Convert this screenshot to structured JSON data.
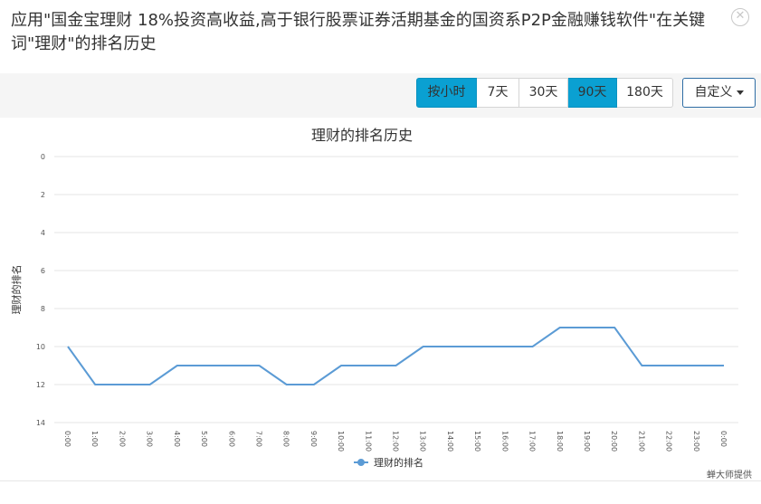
{
  "header": {
    "title": "应用\"国金宝理财 18%投资高收益,高于银行股票证券活期基金的国资系P2P金融赚钱软件\"在关键词\"理财\"的排名历史",
    "close_icon": "close-circle-icon"
  },
  "toolbar": {
    "ranges": [
      {
        "label": "按小时",
        "active": true
      },
      {
        "label": "7天",
        "active": false
      },
      {
        "label": "30天",
        "active": false
      },
      {
        "label": "90天",
        "active": true
      },
      {
        "label": "180天",
        "active": false
      }
    ],
    "custom_label": "自定义",
    "accent": "#0aa0d2"
  },
  "chart_data": {
    "type": "line",
    "title": "理财的排名历史",
    "ylabel": "理财的排名",
    "xlabel": "",
    "ylim": [
      0,
      14
    ],
    "y_reversed": true,
    "yticks": [
      0,
      2,
      4,
      6,
      8,
      10,
      12,
      14
    ],
    "categories": [
      "0:00",
      "1:00",
      "2:00",
      "3:00",
      "4:00",
      "5:00",
      "6:00",
      "7:00",
      "8:00",
      "9:00",
      "10:00",
      "11:00",
      "12:00",
      "13:00",
      "14:00",
      "15:00",
      "16:00",
      "17:00",
      "18:00",
      "19:00",
      "20:00",
      "21:00",
      "22:00",
      "23:00",
      "0:00"
    ],
    "series": [
      {
        "name": "理财的排名",
        "color": "#5b9bd5",
        "values": [
          10,
          12,
          12,
          12,
          11,
          11,
          11,
          11,
          12,
          12,
          11,
          11,
          11,
          10,
          10,
          10,
          10,
          10,
          9,
          9,
          9,
          11,
          11,
          11,
          11
        ]
      }
    ],
    "legend": "bottom-center",
    "grid": true
  },
  "credit": "蝉大师提供"
}
